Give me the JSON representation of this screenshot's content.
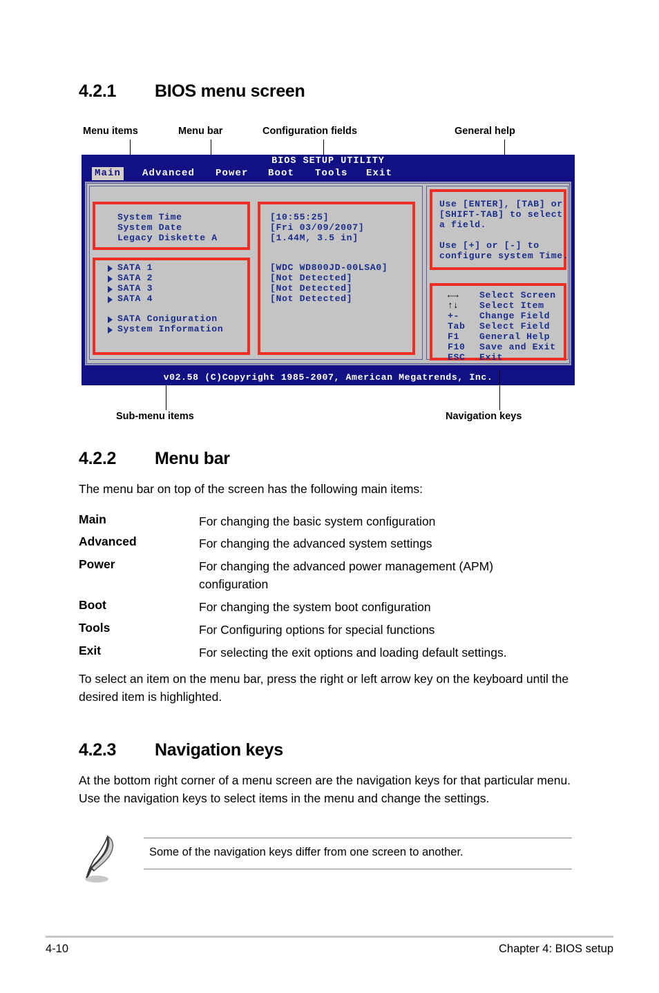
{
  "page": {
    "footer_page_number": "4-10",
    "footer_chapter": "Chapter 4: BIOS setup"
  },
  "sections": {
    "s421": {
      "number": "4.2.1",
      "title": "BIOS menu screen"
    },
    "s422": {
      "number": "4.2.2",
      "title": "Menu bar"
    },
    "s423": {
      "number": "4.2.3",
      "title": "Navigation keys"
    }
  },
  "callouts": {
    "menu_items": "Menu items",
    "menu_bar": "Menu bar",
    "configuration_fields": "Configuration fields",
    "general_help": "General help",
    "sub_menu_items": "Sub-menu items",
    "navigation_keys": "Navigation keys"
  },
  "bios": {
    "title": "BIOS SETUP UTILITY",
    "menu_bar": [
      {
        "label": "Main",
        "active": true
      },
      {
        "label": "Advanced",
        "active": false
      },
      {
        "label": "Power",
        "active": false
      },
      {
        "label": "Boot",
        "active": false
      },
      {
        "label": "Tools",
        "active": false
      },
      {
        "label": "Exit",
        "active": false
      }
    ],
    "menu_items_group1": [
      "System Time",
      "System Date",
      "Legacy Diskette A"
    ],
    "config_group1": [
      "[10:55:25]",
      "[Fri 03/09/2007]",
      "[1.44M, 3.5 in]"
    ],
    "submenu_sata": [
      "SATA 1",
      "SATA 2",
      "SATA 3",
      "SATA 4"
    ],
    "config_sata": [
      "[WDC WD800JD-00LSA0]",
      "[Not Detected]",
      "[Not Detected]",
      "[Not Detected]"
    ],
    "submenu_extra": [
      "SATA Coniguration",
      "System Information"
    ],
    "general_help": [
      "Use [ENTER], [TAB] or",
      "[SHIFT-TAB] to select",
      "a field.",
      "",
      "Use [+] or [-] to",
      "configure system Time."
    ],
    "navigation_keys": [
      {
        "key": "←→",
        "action": "Select Screen",
        "glyph": true
      },
      {
        "key": "↑↓",
        "action": "Select Item",
        "glyph": true
      },
      {
        "key": "+-",
        "action": "Change Field",
        "glyph": false
      },
      {
        "key": "Tab",
        "action": "Select Field",
        "glyph": false
      },
      {
        "key": "F1",
        "action": "General Help",
        "glyph": false
      },
      {
        "key": "F10",
        "action": "Save and Exit",
        "glyph": false
      },
      {
        "key": "ESC",
        "action": "Exit",
        "glyph": false
      }
    ],
    "footer": "v02.58 (C)Copyright 1985-2007, American Megatrends, Inc.",
    "colors": {
      "background": "#111184",
      "panel": "#c4c4c4",
      "text": "#1b2e8c",
      "highlight_bg": "#d4d0c8",
      "annotation_box": "#ee2d24"
    }
  },
  "menu_bar_section": {
    "intro": "The menu bar on top of the screen has the following main items:",
    "items": [
      {
        "term": "Main",
        "definition": "For changing the basic system configuration"
      },
      {
        "term": "Advanced",
        "definition": "For changing the advanced system settings"
      },
      {
        "term": "Power",
        "definition": "For changing the advanced power management (APM) configuration"
      },
      {
        "term": "Boot",
        "definition": "For changing the system boot configuration"
      },
      {
        "term": "Tools",
        "definition": "For Configuring options for special functions"
      },
      {
        "term": "Exit",
        "definition": "For selecting the exit options and loading default settings."
      }
    ],
    "outro": "To select an item on the menu bar, press the right or left arrow key on the keyboard until the desired item is highlighted."
  },
  "navigation_keys_section": {
    "body": "At the bottom right corner of a menu screen are the navigation keys for that particular menu. Use the navigation keys to select items in the menu and change the settings.",
    "note": "Some of the navigation keys differ from one screen to another."
  }
}
